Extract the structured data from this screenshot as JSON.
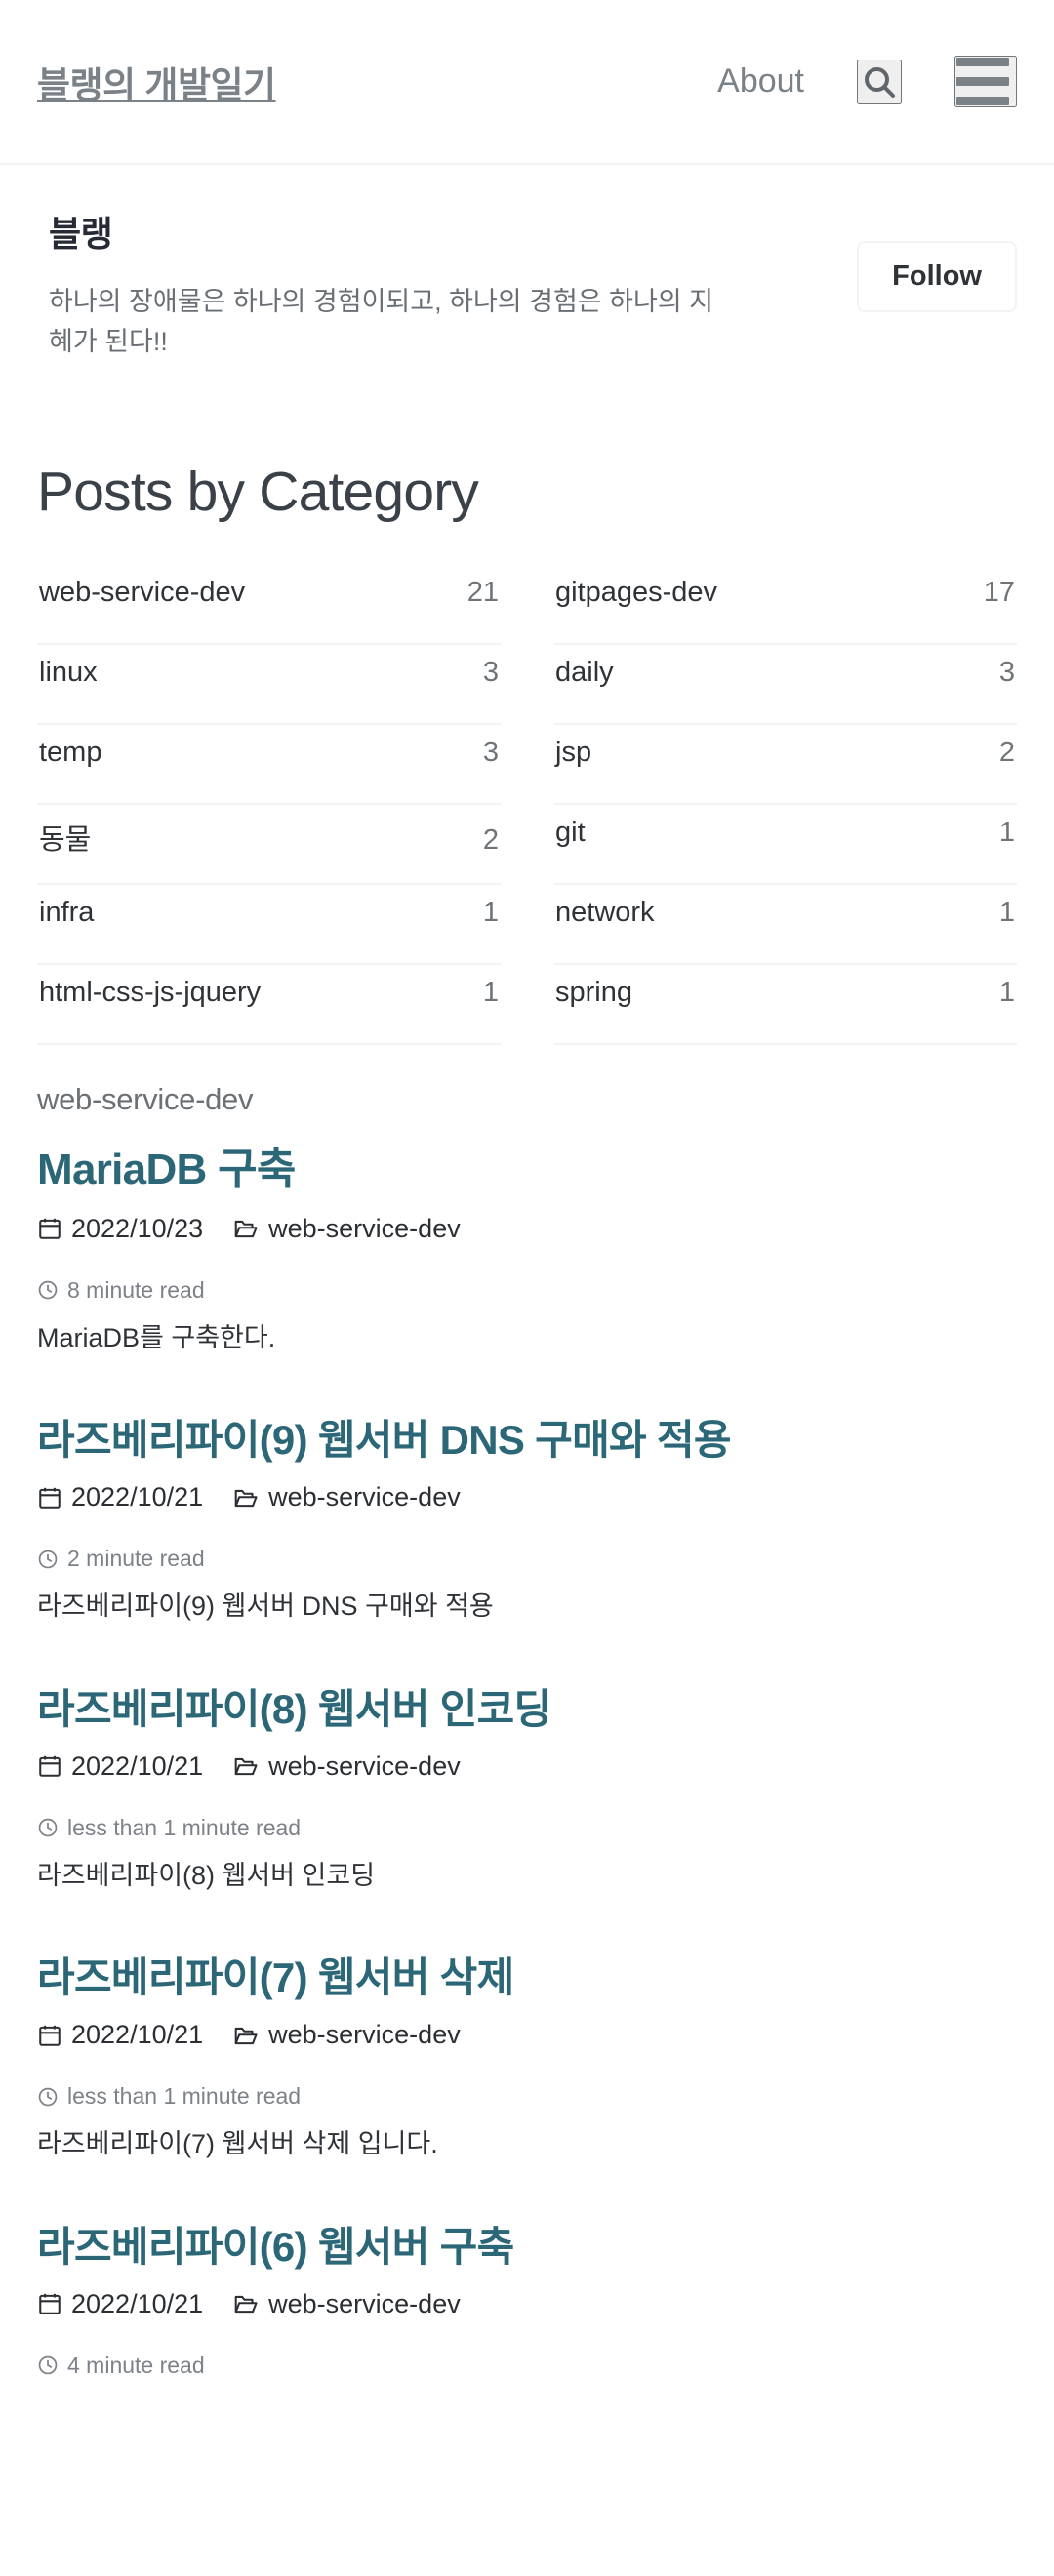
{
  "masthead": {
    "site_title": "블랭의 개발일기",
    "nav": [
      {
        "label": "About",
        "name": "nav-about"
      }
    ],
    "search_icon": "search-icon",
    "menu_icon": "hamburger-menu-icon"
  },
  "author": {
    "name": "블랭",
    "bio": "하나의 장애물은 하나의 경험이되고, 하나의 경험은 하나의 지혜가 된다!!",
    "follow_label": "Follow"
  },
  "page": {
    "title": "Posts by Category"
  },
  "taxonomy": {
    "left": [
      {
        "name": "web-service-dev",
        "count": "21"
      },
      {
        "name": "linux",
        "count": "3"
      },
      {
        "name": "temp",
        "count": "3"
      },
      {
        "name": "동물",
        "count": "2"
      },
      {
        "name": "infra",
        "count": "1"
      },
      {
        "name": "html-css-js-jquery",
        "count": "1"
      }
    ],
    "right": [
      {
        "name": "gitpages-dev",
        "count": "17"
      },
      {
        "name": "daily",
        "count": "3"
      },
      {
        "name": "jsp",
        "count": "2"
      },
      {
        "name": "git",
        "count": "1"
      },
      {
        "name": "network",
        "count": "1"
      },
      {
        "name": "spring",
        "count": "1"
      }
    ]
  },
  "posts_section": {
    "label": "web-service-dev",
    "posts": [
      {
        "title": "MariaDB 구축",
        "date": "2022/10/23",
        "category": "web-service-dev",
        "read_time": "8 minute read",
        "excerpt": "MariaDB를 구축한다."
      },
      {
        "title": "라즈베리파이(9) 웹서버 DNS 구매와 적용",
        "date": "2022/10/21",
        "category": "web-service-dev",
        "read_time": "2 minute read",
        "excerpt": "라즈베리파이(9) 웹서버 DNS 구매와 적용"
      },
      {
        "title": "라즈베리파이(8) 웹서버 인코딩",
        "date": "2022/10/21",
        "category": "web-service-dev",
        "read_time": "less than 1 minute read",
        "excerpt": "라즈베리파이(8) 웹서버 인코딩"
      },
      {
        "title": "라즈베리파이(7) 웹서버 삭제",
        "date": "2022/10/21",
        "category": "web-service-dev",
        "read_time": "less than 1 minute read",
        "excerpt": "라즈베리파이(7) 웹서버 삭제 입니다."
      },
      {
        "title": "라즈베리파이(6) 웹서버 구축",
        "date": "2022/10/21",
        "category": "web-service-dev",
        "read_time": "4 minute read",
        "excerpt": ""
      }
    ]
  },
  "colors": {
    "accent": "#2b6777",
    "muted": "#7a8288",
    "text": "#2f3337",
    "divider": "#f2f3f3"
  }
}
